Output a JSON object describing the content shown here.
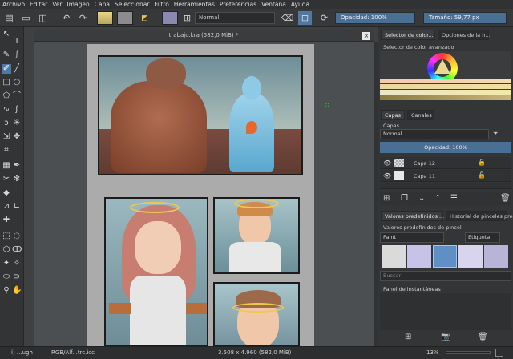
{
  "menu": [
    "Archivo",
    "Editar",
    "Ver",
    "Imagen",
    "Capa",
    "Seleccionar",
    "Filtro",
    "Herramientas",
    "Preferencias",
    "Ventana",
    "Ayuda"
  ],
  "toolbar": {
    "blend_mode": "Normal",
    "opacity": "Opacidad: 100%",
    "size": "Tamaño: 59,77 px",
    "fg_color": "#c9b67a",
    "bg_color": "#8c8c8c"
  },
  "document": {
    "tab_title": "trabajo.kra (582,0 MiB) *"
  },
  "right_panel": {
    "color_tabs": [
      "Selector de color...",
      "Opciones de la h..."
    ],
    "color_header": "Selector de color avanzado",
    "layer_tabs": [
      "Capas",
      "Canales"
    ],
    "layers_header": "Capas",
    "blend_mode": "Normal",
    "opacity": "Opacidad: 100%",
    "layers": [
      {
        "name": "Capa 12"
      },
      {
        "name": "Capa 11"
      }
    ],
    "brush_tabs": [
      "Valores predefinidos ...",
      "Historial de pinceles pre..."
    ],
    "brush_header": "Valores predefinidos de pincel",
    "brush_tag": "Paint",
    "brush_tag2": "Etiqueta",
    "search_placeholder": "Buscar",
    "snapshot_header": "Panel de instantáneas"
  },
  "status": {
    "tool": "i) ...ugh",
    "colorspace": "RGB/Alf...trc.icc",
    "dimensions": "3.508 x 4.960 (582,0 MiB)",
    "zoom": "13%"
  }
}
